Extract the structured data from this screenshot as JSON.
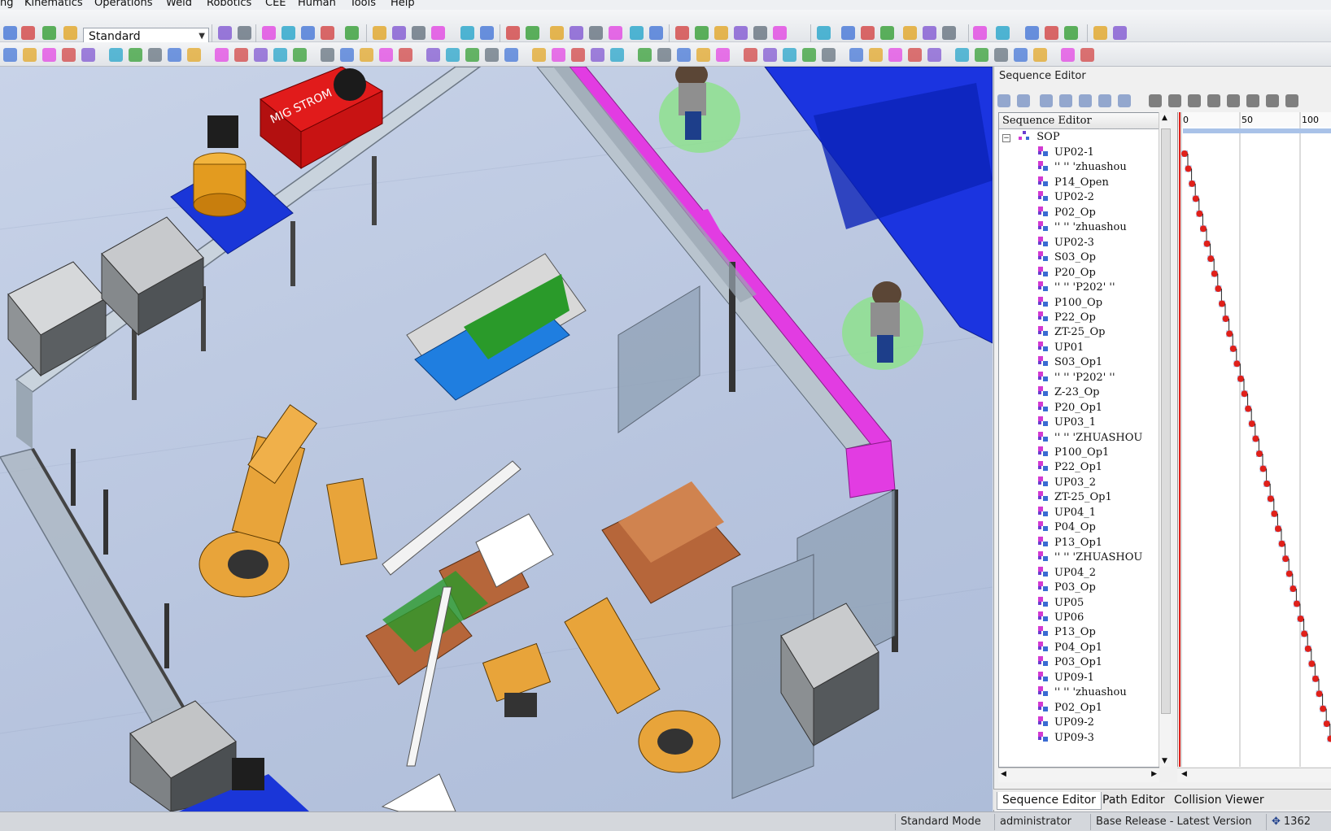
{
  "menu": {
    "items": [
      "ng",
      "Kinematics",
      "Operations",
      "Weld",
      "Robotics",
      "CEE",
      "Human",
      "Tools",
      "Help"
    ]
  },
  "toolbar": {
    "mode_select": "Standard"
  },
  "sequence_editor": {
    "panel_title": "Sequence Editor",
    "tree_header": "Sequence Editor",
    "root": "SOP",
    "operations": [
      "UP02-1",
      "'' '' 'zhuashou",
      "P14_Open",
      "UP02-2",
      "P02_Op",
      "'' '' 'zhuashou",
      "UP02-3",
      "S03_Op",
      "P20_Op",
      "'' '' 'P202' ''",
      "P100_Op",
      "P22_Op",
      "ZT-25_Op",
      "UP01",
      "S03_Op1",
      "'' '' 'P202' ''",
      "Z-23_Op",
      "P20_Op1",
      "UP03_1",
      "'' '' 'ZHUASHOU",
      "P100_Op1",
      "P22_Op1",
      "UP03_2",
      "ZT-25_Op1",
      "UP04_1",
      "P04_Op",
      "P13_Op1",
      "'' '' 'ZHUASHOU",
      "UP04_2",
      "P03_Op",
      "UP05",
      "UP06",
      "P13_Op",
      "P04_Op1",
      "P03_Op1",
      "UP09-1",
      "'' '' 'zhuashou",
      "P02_Op1",
      "UP09-2",
      "UP09-3"
    ],
    "time_ticks": [
      "0",
      "50",
      "100"
    ]
  },
  "tabs": {
    "items": [
      "Sequence Editor",
      "Path Editor",
      "Collision Viewer"
    ]
  },
  "status": {
    "mode": "Standard Mode",
    "user": "administrator",
    "release": "Base Release - Latest Version",
    "coord": "1362"
  },
  "scene": {
    "welder_label": "MIG STROM"
  },
  "colors": {
    "accent_magenta": "#e23ce2",
    "robot_orange": "#e8a43a",
    "conveyor_blue": "#1d3ee0",
    "gantt_bar": "#a9c2e8",
    "gantt_marker": "#e0201a"
  }
}
